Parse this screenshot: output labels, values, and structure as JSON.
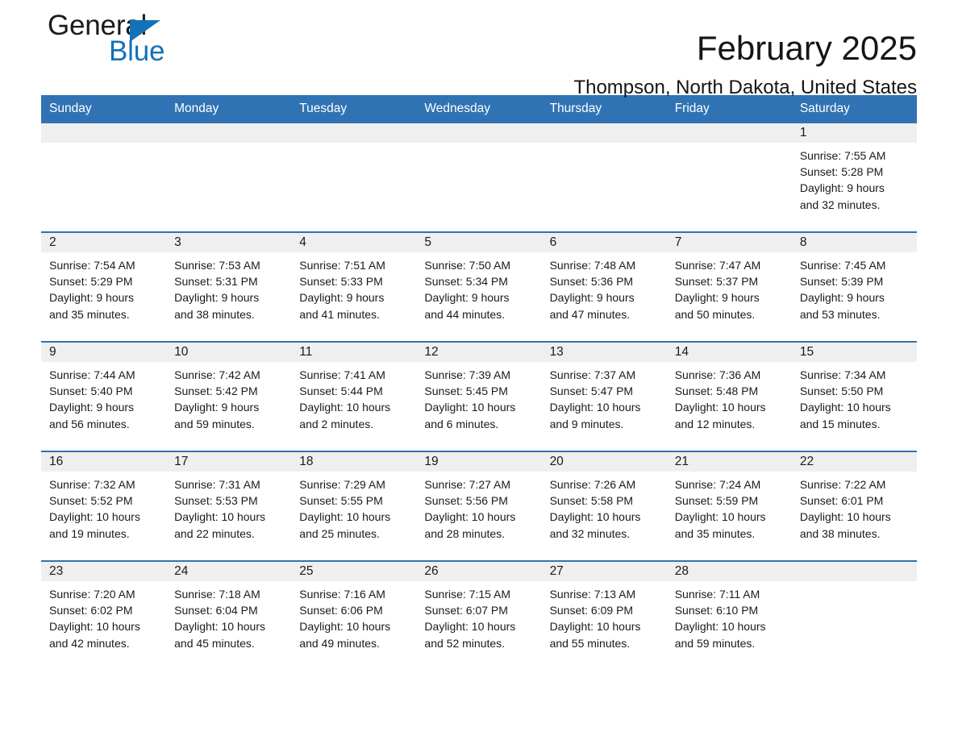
{
  "brand": {
    "name_part1": "General",
    "name_part2": "Blue",
    "triangle_color": "#1372b8",
    "text_color": "#1b1b1b"
  },
  "header": {
    "title": "February 2025",
    "subtitle": "Thompson, North Dakota, United States"
  },
  "theme": {
    "header_blue": "#3073b4",
    "daynum_band": "#efeff0",
    "page_background": "#ffffff",
    "text": "#1a1a1a"
  },
  "weekday_headers": [
    "Sunday",
    "Monday",
    "Tuesday",
    "Wednesday",
    "Thursday",
    "Friday",
    "Saturday"
  ],
  "labels": {
    "sunrise_prefix": "Sunrise:",
    "sunset_prefix": "Sunset:",
    "daylight_prefix": "Daylight:"
  },
  "weeks": [
    [
      {
        "day": "",
        "sunrise": "",
        "sunset": "",
        "daylight_line1": "",
        "daylight_line2": "",
        "empty": true
      },
      {
        "day": "",
        "sunrise": "",
        "sunset": "",
        "daylight_line1": "",
        "daylight_line2": "",
        "empty": true
      },
      {
        "day": "",
        "sunrise": "",
        "sunset": "",
        "daylight_line1": "",
        "daylight_line2": "",
        "empty": true
      },
      {
        "day": "",
        "sunrise": "",
        "sunset": "",
        "daylight_line1": "",
        "daylight_line2": "",
        "empty": true
      },
      {
        "day": "",
        "sunrise": "",
        "sunset": "",
        "daylight_line1": "",
        "daylight_line2": "",
        "empty": true
      },
      {
        "day": "",
        "sunrise": "",
        "sunset": "",
        "daylight_line1": "",
        "daylight_line2": "",
        "empty": true
      },
      {
        "day": "1",
        "sunrise": "Sunrise: 7:55 AM",
        "sunset": "Sunset: 5:28 PM",
        "daylight_line1": "Daylight: 9 hours",
        "daylight_line2": "and 32 minutes.",
        "empty": false
      }
    ],
    [
      {
        "day": "2",
        "sunrise": "Sunrise: 7:54 AM",
        "sunset": "Sunset: 5:29 PM",
        "daylight_line1": "Daylight: 9 hours",
        "daylight_line2": "and 35 minutes.",
        "empty": false
      },
      {
        "day": "3",
        "sunrise": "Sunrise: 7:53 AM",
        "sunset": "Sunset: 5:31 PM",
        "daylight_line1": "Daylight: 9 hours",
        "daylight_line2": "and 38 minutes.",
        "empty": false
      },
      {
        "day": "4",
        "sunrise": "Sunrise: 7:51 AM",
        "sunset": "Sunset: 5:33 PM",
        "daylight_line1": "Daylight: 9 hours",
        "daylight_line2": "and 41 minutes.",
        "empty": false
      },
      {
        "day": "5",
        "sunrise": "Sunrise: 7:50 AM",
        "sunset": "Sunset: 5:34 PM",
        "daylight_line1": "Daylight: 9 hours",
        "daylight_line2": "and 44 minutes.",
        "empty": false
      },
      {
        "day": "6",
        "sunrise": "Sunrise: 7:48 AM",
        "sunset": "Sunset: 5:36 PM",
        "daylight_line1": "Daylight: 9 hours",
        "daylight_line2": "and 47 minutes.",
        "empty": false
      },
      {
        "day": "7",
        "sunrise": "Sunrise: 7:47 AM",
        "sunset": "Sunset: 5:37 PM",
        "daylight_line1": "Daylight: 9 hours",
        "daylight_line2": "and 50 minutes.",
        "empty": false
      },
      {
        "day": "8",
        "sunrise": "Sunrise: 7:45 AM",
        "sunset": "Sunset: 5:39 PM",
        "daylight_line1": "Daylight: 9 hours",
        "daylight_line2": "and 53 minutes.",
        "empty": false
      }
    ],
    [
      {
        "day": "9",
        "sunrise": "Sunrise: 7:44 AM",
        "sunset": "Sunset: 5:40 PM",
        "daylight_line1": "Daylight: 9 hours",
        "daylight_line2": "and 56 minutes.",
        "empty": false
      },
      {
        "day": "10",
        "sunrise": "Sunrise: 7:42 AM",
        "sunset": "Sunset: 5:42 PM",
        "daylight_line1": "Daylight: 9 hours",
        "daylight_line2": "and 59 minutes.",
        "empty": false
      },
      {
        "day": "11",
        "sunrise": "Sunrise: 7:41 AM",
        "sunset": "Sunset: 5:44 PM",
        "daylight_line1": "Daylight: 10 hours",
        "daylight_line2": "and 2 minutes.",
        "empty": false
      },
      {
        "day": "12",
        "sunrise": "Sunrise: 7:39 AM",
        "sunset": "Sunset: 5:45 PM",
        "daylight_line1": "Daylight: 10 hours",
        "daylight_line2": "and 6 minutes.",
        "empty": false
      },
      {
        "day": "13",
        "sunrise": "Sunrise: 7:37 AM",
        "sunset": "Sunset: 5:47 PM",
        "daylight_line1": "Daylight: 10 hours",
        "daylight_line2": "and 9 minutes.",
        "empty": false
      },
      {
        "day": "14",
        "sunrise": "Sunrise: 7:36 AM",
        "sunset": "Sunset: 5:48 PM",
        "daylight_line1": "Daylight: 10 hours",
        "daylight_line2": "and 12 minutes.",
        "empty": false
      },
      {
        "day": "15",
        "sunrise": "Sunrise: 7:34 AM",
        "sunset": "Sunset: 5:50 PM",
        "daylight_line1": "Daylight: 10 hours",
        "daylight_line2": "and 15 minutes.",
        "empty": false
      }
    ],
    [
      {
        "day": "16",
        "sunrise": "Sunrise: 7:32 AM",
        "sunset": "Sunset: 5:52 PM",
        "daylight_line1": "Daylight: 10 hours",
        "daylight_line2": "and 19 minutes.",
        "empty": false
      },
      {
        "day": "17",
        "sunrise": "Sunrise: 7:31 AM",
        "sunset": "Sunset: 5:53 PM",
        "daylight_line1": "Daylight: 10 hours",
        "daylight_line2": "and 22 minutes.",
        "empty": false
      },
      {
        "day": "18",
        "sunrise": "Sunrise: 7:29 AM",
        "sunset": "Sunset: 5:55 PM",
        "daylight_line1": "Daylight: 10 hours",
        "daylight_line2": "and 25 minutes.",
        "empty": false
      },
      {
        "day": "19",
        "sunrise": "Sunrise: 7:27 AM",
        "sunset": "Sunset: 5:56 PM",
        "daylight_line1": "Daylight: 10 hours",
        "daylight_line2": "and 28 minutes.",
        "empty": false
      },
      {
        "day": "20",
        "sunrise": "Sunrise: 7:26 AM",
        "sunset": "Sunset: 5:58 PM",
        "daylight_line1": "Daylight: 10 hours",
        "daylight_line2": "and 32 minutes.",
        "empty": false
      },
      {
        "day": "21",
        "sunrise": "Sunrise: 7:24 AM",
        "sunset": "Sunset: 5:59 PM",
        "daylight_line1": "Daylight: 10 hours",
        "daylight_line2": "and 35 minutes.",
        "empty": false
      },
      {
        "day": "22",
        "sunrise": "Sunrise: 7:22 AM",
        "sunset": "Sunset: 6:01 PM",
        "daylight_line1": "Daylight: 10 hours",
        "daylight_line2": "and 38 minutes.",
        "empty": false
      }
    ],
    [
      {
        "day": "23",
        "sunrise": "Sunrise: 7:20 AM",
        "sunset": "Sunset: 6:02 PM",
        "daylight_line1": "Daylight: 10 hours",
        "daylight_line2": "and 42 minutes.",
        "empty": false
      },
      {
        "day": "24",
        "sunrise": "Sunrise: 7:18 AM",
        "sunset": "Sunset: 6:04 PM",
        "daylight_line1": "Daylight: 10 hours",
        "daylight_line2": "and 45 minutes.",
        "empty": false
      },
      {
        "day": "25",
        "sunrise": "Sunrise: 7:16 AM",
        "sunset": "Sunset: 6:06 PM",
        "daylight_line1": "Daylight: 10 hours",
        "daylight_line2": "and 49 minutes.",
        "empty": false
      },
      {
        "day": "26",
        "sunrise": "Sunrise: 7:15 AM",
        "sunset": "Sunset: 6:07 PM",
        "daylight_line1": "Daylight: 10 hours",
        "daylight_line2": "and 52 minutes.",
        "empty": false
      },
      {
        "day": "27",
        "sunrise": "Sunrise: 7:13 AM",
        "sunset": "Sunset: 6:09 PM",
        "daylight_line1": "Daylight: 10 hours",
        "daylight_line2": "and 55 minutes.",
        "empty": false
      },
      {
        "day": "28",
        "sunrise": "Sunrise: 7:11 AM",
        "sunset": "Sunset: 6:10 PM",
        "daylight_line1": "Daylight: 10 hours",
        "daylight_line2": "and 59 minutes.",
        "empty": false
      },
      {
        "day": "",
        "sunrise": "",
        "sunset": "",
        "daylight_line1": "",
        "daylight_line2": "",
        "empty": true
      }
    ]
  ]
}
